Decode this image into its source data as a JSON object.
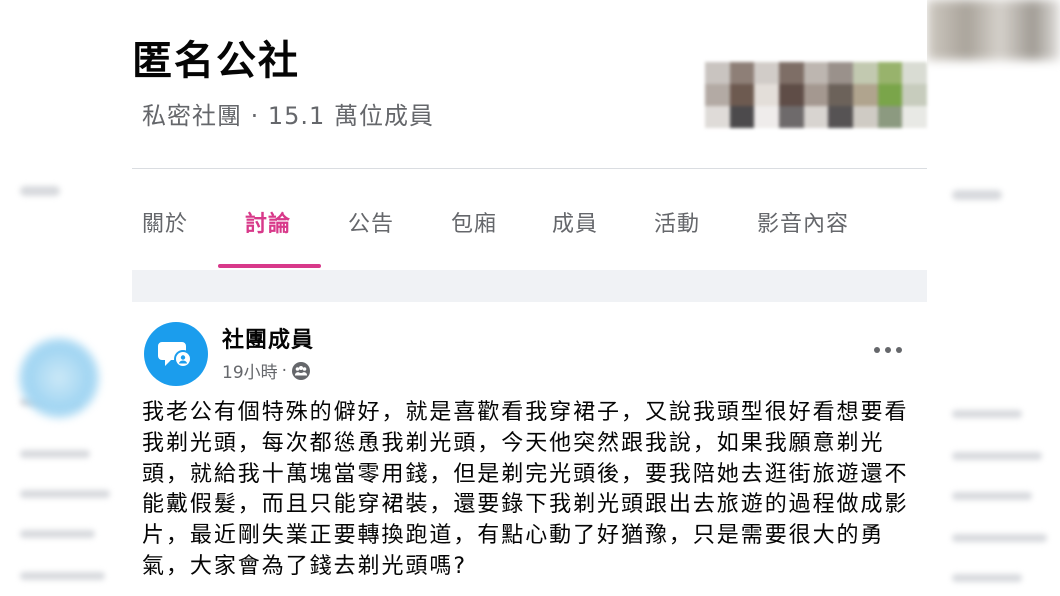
{
  "group": {
    "title": "匿名公社",
    "meta": "私密社團 · 15.1 萬位成員"
  },
  "tabs": [
    {
      "label": "關於"
    },
    {
      "label": "討論"
    },
    {
      "label": "公告"
    },
    {
      "label": "包廂"
    },
    {
      "label": "成員"
    },
    {
      "label": "活動"
    },
    {
      "label": "影音內容"
    }
  ],
  "active_tab": "討論",
  "post": {
    "author": "社團成員",
    "time": "19小時",
    "separator": "·",
    "body": "我老公有個特殊的僻好，就是喜歡看我穿裙子，又說我頭型很好看想要看我剃光頭，每次都慫恿我剃光頭，今天他突然跟我說，如果我願意剃光頭，就給我十萬塊當零用錢，但是剃完光頭後，要我陪她去逛街旅遊還不能戴假髮，而且只能穿裙裝，還要錄下我剃光頭跟出去旅遊的過程做成影片，最近剛失業正要轉換跑道，有點心動了好猶豫，只是需要很大的勇氣，大家會為了錢去剃光頭嗎?"
  },
  "icons": {
    "avatar": "anonymous-member-icon",
    "privacy": "group-members-icon",
    "more": "more-horizontal-icon"
  },
  "colors": {
    "accent": "#d8398a",
    "avatar_bg": "#1b9ded",
    "text_primary": "#050505",
    "text_secondary": "#65676b",
    "feed_bg": "#f0f2f5"
  }
}
